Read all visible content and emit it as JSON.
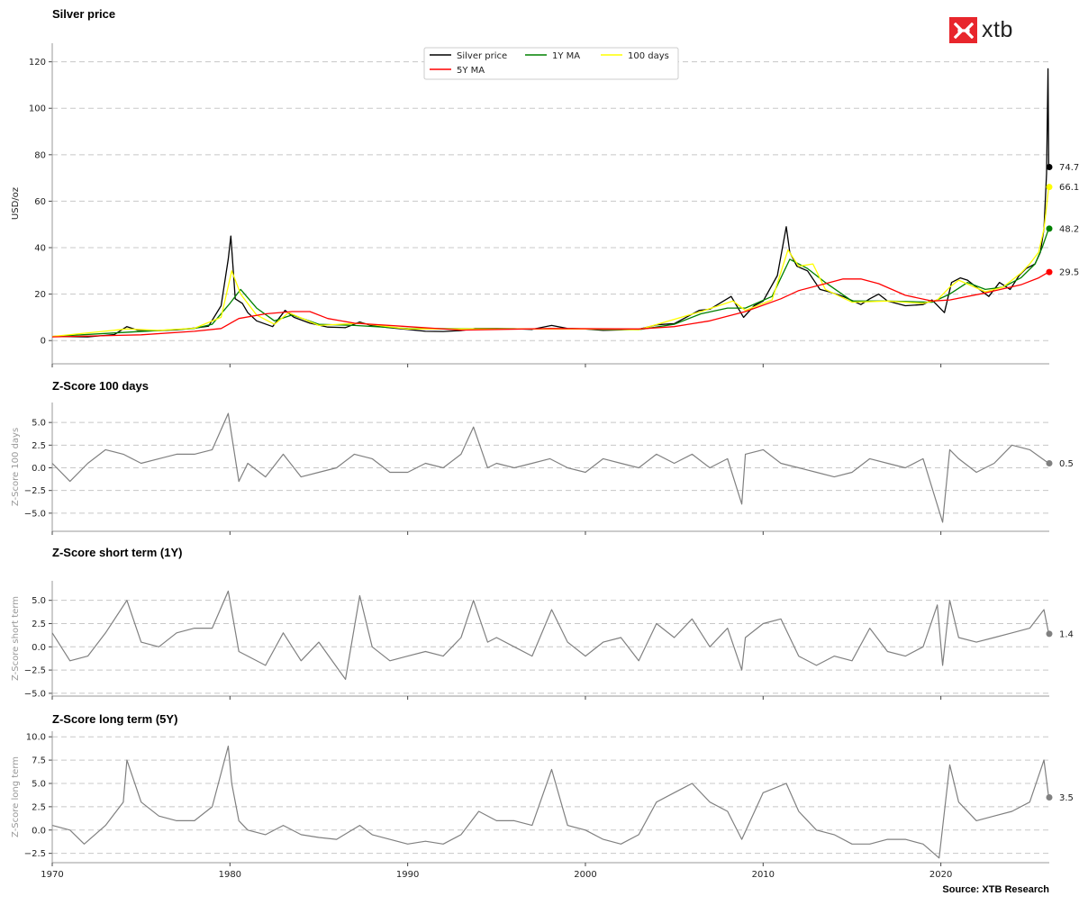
{
  "logo": {
    "text": "xtb"
  },
  "source": "Source: XTB Research",
  "chart_data": [
    {
      "type": "line",
      "title": "Silver price",
      "ylabel": "USD/oz",
      "ylim": [
        -10,
        128
      ],
      "yticks": [
        0,
        20,
        40,
        60,
        80,
        100,
        120
      ],
      "ytick_labels": [
        "0",
        "20",
        "40",
        "60",
        "80",
        "100",
        "120"
      ],
      "xlim": [
        1970,
        2026.1
      ],
      "grid": "horizontal dashed",
      "legend_position": "top-center",
      "series": [
        {
          "name": "Silver price",
          "color": "#000000",
          "x": [
            1970,
            1972,
            1973.5,
            1974.2,
            1974.8,
            1976,
            1977,
            1978,
            1978.8,
            1979.5,
            1979.9,
            1980.05,
            1980.3,
            1980.7,
            1981,
            1981.5,
            1982.4,
            1983.1,
            1983.6,
            1984.5,
            1985.5,
            1986.5,
            1987.3,
            1988,
            1989,
            1990,
            1991,
            1992,
            1993,
            1993.8,
            1995,
            1996,
            1997,
            1998.1,
            1999,
            2000,
            2001,
            2002,
            2003,
            2004,
            2005,
            2006.4,
            2007,
            2008.2,
            2008.9,
            2009.5,
            2010,
            2010.8,
            2011.3,
            2011.5,
            2011.9,
            2012.5,
            2013.2,
            2013.7,
            2014.5,
            2015.5,
            2016,
            2016.5,
            2017,
            2018,
            2019,
            2019.5,
            2020.2,
            2020.6,
            2021.1,
            2021.5,
            2022,
            2022.7,
            2023.3,
            2023.9,
            2024.4,
            2024.8,
            2025.3,
            2025.6,
            2025.8,
            2025.95,
            2026.03,
            2026.07
          ],
          "y": [
            1.8,
            1.6,
            2.6,
            6,
            4.5,
            4.3,
            4.6,
            5.4,
            6.2,
            15,
            35,
            45,
            18,
            16,
            12,
            8.5,
            6,
            13,
            10,
            7.5,
            5.8,
            5.6,
            8,
            6.4,
            5.5,
            4.8,
            4,
            3.9,
            4.3,
            5.2,
            5.2,
            5.1,
            4.8,
            6.5,
            5.2,
            5.0,
            4.4,
            4.6,
            4.9,
            6.8,
            7.3,
            13,
            13.5,
            19,
            10,
            15,
            17,
            28,
            49,
            38,
            32,
            30,
            22,
            21,
            19,
            15.5,
            18,
            20,
            17,
            15,
            15.5,
            17.5,
            12,
            25,
            27,
            26,
            23,
            19,
            25,
            22,
            28,
            31,
            33,
            38,
            48,
            72,
            117,
            74.7
          ]
        },
        {
          "name": "1Y MA",
          "color": "#008000",
          "x": [
            1970,
            1974,
            1978,
            1979,
            1980,
            1980.6,
            1981.5,
            1982.5,
            1983.5,
            1985,
            1987,
            1990,
            1995,
            2000,
            2003,
            2005,
            2006.5,
            2008,
            2009,
            2010.5,
            2011.5,
            2012.5,
            2013.5,
            2015,
            2017,
            2019.5,
            2020.5,
            2021.5,
            2022.5,
            2023.5,
            2024.5,
            2025.3,
            2025.7,
            2026.07
          ],
          "y": [
            1.8,
            3.5,
            5.2,
            7,
            16,
            22,
            14,
            8.5,
            11,
            7,
            6.5,
            5.2,
            5.0,
            5.0,
            4.7,
            7,
            11.5,
            14,
            14,
            19,
            35,
            31,
            25,
            17,
            17,
            16.5,
            20,
            25,
            22,
            23,
            27,
            33,
            40,
            48.2
          ]
        },
        {
          "name": "100 days",
          "color": "#ffff00",
          "x": [
            1970,
            1974.2,
            1976,
            1978,
            1979.5,
            1980.1,
            1980.6,
            1981.5,
            1982.5,
            1983.3,
            1985,
            1987.3,
            1990,
            1995,
            2000,
            2003,
            2006.5,
            2008.3,
            2009,
            2010.5,
            2011.4,
            2012,
            2012.8,
            2013.5,
            2015,
            2017,
            2019,
            2019.8,
            2020.5,
            2021,
            2022.5,
            2023.5,
            2024.5,
            2025,
            2025.5,
            2025.8,
            2026.07
          ],
          "y": [
            1.8,
            5,
            4.4,
            5.3,
            10,
            30,
            20,
            11,
            7,
            12,
            6.5,
            7.5,
            5,
            5,
            5,
            4.7,
            12.5,
            17,
            13,
            17.5,
            39,
            32,
            33,
            22,
            16.5,
            17,
            16,
            17.5,
            23,
            26,
            21,
            23,
            29,
            33,
            38,
            48,
            66.1
          ]
        },
        {
          "name": "5Y MA",
          "color": "#ff0000",
          "x": [
            1970,
            1975,
            1978,
            1979.5,
            1980.5,
            1982,
            1983.5,
            1984.5,
            1985.5,
            1987,
            1990,
            1993,
            1998,
            2003,
            2005,
            2007,
            2009,
            2011,
            2012,
            2013.5,
            2014.5,
            2015.5,
            2016.5,
            2018,
            2019.5,
            2020.5,
            2022.5,
            2024.5,
            2025.5,
            2026.07
          ],
          "y": [
            1.6,
            2.5,
            4,
            5.2,
            9.5,
            11.5,
            12.5,
            12.5,
            9.5,
            7.5,
            6,
            4.5,
            5.2,
            5,
            6,
            8.5,
            12.5,
            18,
            21.5,
            24.5,
            26.5,
            26.5,
            24.5,
            19.5,
            17,
            17.5,
            20.5,
            24,
            27,
            29.5
          ]
        }
      ],
      "end_labels": [
        {
          "value": 74.7,
          "text": "74.7",
          "color": "#000000"
        },
        {
          "value": 66.1,
          "text": "66.1",
          "color": "#ffff00"
        },
        {
          "value": 48.2,
          "text": "48.2",
          "color": "#008000"
        },
        {
          "value": 29.5,
          "text": "29.5",
          "color": "#ff0000"
        }
      ]
    },
    {
      "type": "line",
      "title": "Z-Score 100 days",
      "ylabel": "Z-Score 100 days",
      "ylim": [
        -7,
        7.2
      ],
      "yticks": [
        -5,
        -2.5,
        0,
        2.5,
        5
      ],
      "ytick_labels": [
        "−5.0",
        "−2.5",
        "0.0",
        "2.5",
        "5.0"
      ],
      "grid": "horizontal dashed",
      "series": [
        {
          "color": "#808080",
          "x": [
            1970,
            1971,
            1972,
            1973,
            1974,
            1975,
            1976,
            1977,
            1978,
            1979,
            1979.9,
            1980.5,
            1981,
            1982,
            1983,
            1984,
            1985,
            1986,
            1987,
            1988,
            1989,
            1990,
            1991,
            1992,
            1993,
            1993.7,
            1994.5,
            1995,
            1996,
            1997,
            1998,
            1999,
            2000,
            2001,
            2002,
            2003,
            2004,
            2005,
            2006,
            2007,
            2008,
            2008.8,
            2009,
            2010,
            2011,
            2012,
            2013,
            2014,
            2015,
            2016,
            2017,
            2018,
            2019,
            2020.1,
            2020.5,
            2021,
            2022,
            2023,
            2024,
            2025,
            2026.07
          ],
          "y": [
            0.5,
            -1.5,
            0.5,
            2.0,
            1.5,
            0.5,
            1.0,
            1.5,
            1.5,
            2.0,
            6.0,
            -1.5,
            0.5,
            -1.0,
            1.5,
            -1.0,
            -0.5,
            0.0,
            1.5,
            1.0,
            -0.5,
            -0.5,
            0.5,
            0.0,
            1.5,
            4.5,
            0.0,
            0.5,
            0.0,
            0.5,
            1.0,
            0.0,
            -0.5,
            1.0,
            0.5,
            0.0,
            1.5,
            0.5,
            1.5,
            0.0,
            1.0,
            -4.0,
            1.5,
            2.0,
            0.5,
            0.0,
            -0.5,
            -1.0,
            -0.5,
            1.0,
            0.5,
            0.0,
            1.0,
            -6.0,
            2.0,
            1.0,
            -0.5,
            0.5,
            2.5,
            2.0,
            0.5
          ]
        }
      ],
      "end_labels": [
        {
          "value": 0.5,
          "text": "0.5",
          "color": "#808080"
        }
      ]
    },
    {
      "type": "line",
      "title": "Z-Score short term (1Y)",
      "ylabel": "Z-Score short term",
      "ylim": [
        -5.3,
        7.1
      ],
      "yticks": [
        -5,
        -2.5,
        0,
        2.5,
        5
      ],
      "ytick_labels": [
        "−5.0",
        "−2.5",
        "0.0",
        "2.5",
        "5.0"
      ],
      "grid": "horizontal dashed",
      "series": [
        {
          "color": "#808080",
          "x": [
            1970,
            1971,
            1972,
            1973,
            1974.2,
            1975,
            1976,
            1977,
            1978,
            1979,
            1979.9,
            1980.5,
            1981,
            1982,
            1983,
            1984,
            1985,
            1986.5,
            1987.3,
            1988,
            1989,
            1990,
            1991,
            1992,
            1993,
            1993.7,
            1994.5,
            1995,
            1996,
            1997,
            1998.1,
            1999,
            2000,
            2001,
            2002,
            2003,
            2004,
            2005,
            2006,
            2007,
            2008,
            2008.8,
            2009,
            2010,
            2011,
            2012,
            2013,
            2014,
            2015,
            2016,
            2017,
            2018,
            2019,
            2019.8,
            2020.1,
            2020.5,
            2021,
            2022,
            2023,
            2024,
            2025,
            2025.8,
            2026.07
          ],
          "y": [
            1.5,
            -1.5,
            -1.0,
            1.5,
            5.0,
            0.5,
            0.0,
            1.5,
            2.0,
            2.0,
            6.0,
            -0.5,
            -1.0,
            -2.0,
            1.5,
            -1.5,
            0.5,
            -3.5,
            5.5,
            0.0,
            -1.5,
            -1.0,
            -0.5,
            -1.0,
            1.0,
            5.0,
            0.5,
            1.0,
            0.0,
            -1.0,
            4.0,
            0.5,
            -1.0,
            0.5,
            1.0,
            -1.5,
            2.5,
            1.0,
            3.0,
            0.0,
            2.0,
            -2.5,
            1.0,
            2.5,
            3.0,
            -1.0,
            -2.0,
            -1.0,
            -1.5,
            2.0,
            -0.5,
            -1.0,
            0.0,
            4.5,
            -2.0,
            5.0,
            1.0,
            0.5,
            1.0,
            1.5,
            2.0,
            4.0,
            1.4
          ]
        }
      ],
      "end_labels": [
        {
          "value": 1.4,
          "text": "1.4",
          "color": "#808080"
        }
      ]
    },
    {
      "type": "line",
      "title": "Z-Score long term (5Y)",
      "ylabel": "Z-Score long term",
      "ylim": [
        -3.5,
        10.6
      ],
      "yticks": [
        -2.5,
        0,
        2.5,
        5,
        7.5,
        10
      ],
      "ytick_labels": [
        "−2.5",
        "0.0",
        "2.5",
        "5.0",
        "7.5",
        "10.0"
      ],
      "xticks": [
        1970,
        1980,
        1990,
        2000,
        2010,
        2020
      ],
      "xtick_labels": [
        "1970",
        "1980",
        "1990",
        "2000",
        "2010",
        "2020"
      ],
      "grid": "horizontal dashed",
      "series": [
        {
          "color": "#808080",
          "x": [
            1970,
            1971,
            1971.8,
            1973,
            1974,
            1974.2,
            1975,
            1976,
            1977,
            1978,
            1979,
            1979.9,
            1980.1,
            1980.5,
            1981,
            1982,
            1983,
            1984,
            1985,
            1986,
            1987.3,
            1988,
            1990,
            1991,
            1992,
            1993,
            1994,
            1995,
            1996,
            1997,
            1998.1,
            1999,
            2000,
            2001,
            2002,
            2003,
            2004,
            2005,
            2006,
            2007,
            2008,
            2008.8,
            2010,
            2011.3,
            2012,
            2013,
            2014,
            2015,
            2016,
            2017,
            2018,
            2019,
            2019.9,
            2020.5,
            2021,
            2022,
            2023,
            2024,
            2025,
            2025.8,
            2026.07
          ],
          "y": [
            0.5,
            0.0,
            -1.5,
            0.5,
            3.0,
            7.5,
            3.0,
            1.5,
            1.0,
            1.0,
            2.5,
            9.0,
            5.0,
            1.0,
            0.0,
            -0.5,
            0.5,
            -0.5,
            -0.8,
            -1.0,
            0.5,
            -0.5,
            -1.5,
            -1.2,
            -1.5,
            -0.5,
            2.0,
            1.0,
            1.0,
            0.5,
            6.5,
            0.5,
            0.0,
            -1.0,
            -1.5,
            -0.5,
            3.0,
            4.0,
            5.0,
            3.0,
            2.0,
            -1.0,
            4.0,
            5.0,
            2.0,
            0.0,
            -0.5,
            -1.5,
            -1.5,
            -1.0,
            -1.0,
            -1.5,
            -3.0,
            7.0,
            3.0,
            1.0,
            1.5,
            2.0,
            3.0,
            7.5,
            3.5
          ]
        }
      ],
      "end_labels": [
        {
          "value": 3.5,
          "text": "3.5",
          "color": "#808080"
        }
      ]
    }
  ]
}
